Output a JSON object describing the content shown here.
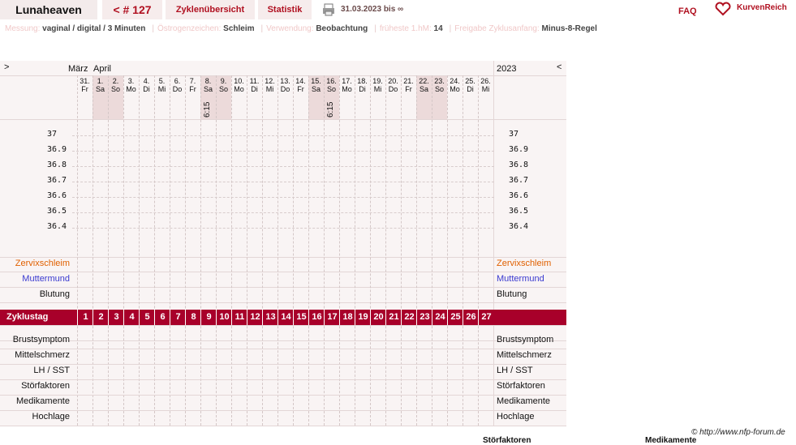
{
  "header": {
    "user": "Lunaheaven",
    "cycle": "< # 127",
    "tab_overview": "Zyklenübersicht",
    "tab_stats": "Statistik",
    "range": "31.03.2023 bis ∞",
    "faq": "FAQ",
    "brand": "KurvenReich"
  },
  "info": [
    {
      "k": "Messung:",
      "v": "vaginal / digital / 3 Minuten"
    },
    {
      "k": "Östrogenzeichen:",
      "v": "Schleim"
    },
    {
      "k": "Verwendung:",
      "v": "Beobachtung"
    },
    {
      "k": "früheste 1.hM:",
      "v": "14"
    },
    {
      "k": "Freigabe Zyklusanfang:",
      "v": "Minus-8-Regel"
    }
  ],
  "nav": {
    "prev": ">",
    "next": "<",
    "month1": "März",
    "month2": "April",
    "year": "2023"
  },
  "days": [
    [
      "31.",
      "Fr"
    ],
    [
      "1.",
      "Sa"
    ],
    [
      "2.",
      "So"
    ],
    [
      "3.",
      "Mo"
    ],
    [
      "4.",
      "Di"
    ],
    [
      "5.",
      "Mi"
    ],
    [
      "6.",
      "Do"
    ],
    [
      "7.",
      "Fr"
    ],
    [
      "8.",
      "Sa"
    ],
    [
      "9.",
      "So"
    ],
    [
      "10.",
      "Mo"
    ],
    [
      "11.",
      "Di"
    ],
    [
      "12.",
      "Mi"
    ],
    [
      "13.",
      "Do"
    ],
    [
      "14.",
      "Fr"
    ],
    [
      "15.",
      "Sa"
    ],
    [
      "16.",
      "So"
    ],
    [
      "17.",
      "Mo"
    ],
    [
      "18.",
      "Di"
    ],
    [
      "19.",
      "Mi"
    ],
    [
      "20.",
      "Do"
    ],
    [
      "21.",
      "Fr"
    ],
    [
      "22.",
      "Sa"
    ],
    [
      "23.",
      "So"
    ],
    [
      "24.",
      "Mo"
    ],
    [
      "25.",
      "Di"
    ],
    [
      "26.",
      "Mi"
    ]
  ],
  "times": [
    {
      "day": 8,
      "t": "6:15"
    },
    {
      "day": 16,
      "t": "6:15"
    }
  ],
  "temps": [
    "37",
    "36.9",
    "36.8",
    "36.7",
    "36.6",
    "36.5",
    "36.4"
  ],
  "rows_top": [
    "Zervixschleim",
    "Muttermund",
    "Blutung"
  ],
  "zyklustag": "Zyklustag",
  "cycle_days": [
    "1",
    "2",
    "3",
    "4",
    "5",
    "6",
    "7",
    "8",
    "9",
    "10",
    "11",
    "12",
    "13",
    "14",
    "15",
    "16",
    "17",
    "18",
    "19",
    "20",
    "21",
    "22",
    "23",
    "24",
    "25",
    "26",
    "27"
  ],
  "rows_bottom": [
    "Brustsymptom",
    "Mittelschmerz",
    "LH / SST",
    "Störfaktoren",
    "Medikamente",
    "Hochlage"
  ],
  "footer": {
    "copyright": "© http://www.nfp-forum.de",
    "cut1": "Störfaktoren",
    "cut2": "Medikamente"
  },
  "colors": {
    "accent": "#b01020",
    "zervix": "#e06000",
    "mutter": "#3a3ad0"
  }
}
